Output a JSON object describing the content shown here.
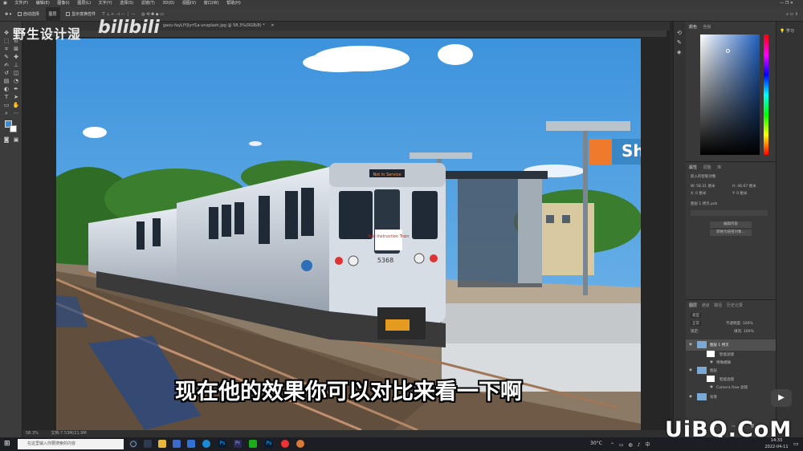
{
  "menubar": {
    "items": [
      "文件(F)",
      "编辑(E)",
      "图像(I)",
      "图层(L)",
      "文字(Y)",
      "选择(S)",
      "滤镜(T)",
      "3D(D)",
      "视图(V)",
      "窗口(W)",
      "帮助(H)"
    ]
  },
  "options": {
    "auto_select": "自动选择",
    "layer_select": "图层",
    "show_transform": "显示变换控件"
  },
  "document": {
    "tab_title": "gaou-fayLfYjlyrf1a-unsplash.jpg @ 58.3%(RGB/8) *"
  },
  "overlay": {
    "watermark": "野生设计湿",
    "bili": "bilibili",
    "subtitle": "现在他的效果你可以对比来看一下啊",
    "site_logo": "UiBQ.CoM"
  },
  "photo": {
    "station_sign": "She",
    "train_number": "5368",
    "train_label": "Not in Service",
    "rail_badge": "Rail Instruction Train"
  },
  "statusbar": {
    "zoom": "58.3%",
    "doc_size": "文档:7.53M/21.9M"
  },
  "panels": {
    "color": {
      "tabs": [
        "颜色",
        "色板"
      ]
    },
    "learn": "学习",
    "properties": {
      "tabs": [
        "属性",
        "调整",
        "库"
      ],
      "title": "嵌入的智能对象",
      "w_label": "W: 58.31 厘米",
      "h_label": "H: 46.67 厘米",
      "x_label": "X: 0 厘米",
      "y_label": "Y: 0 厘米",
      "file": "图层 1 拷贝.psb",
      "button_edit": "编辑内容",
      "button_convert": "转换为链接对象..."
    },
    "layers": {
      "tabs": [
        "图层",
        "通道",
        "路径",
        "历史记录"
      ],
      "kind": "类型",
      "blend": "正常",
      "opacity": "不透明度: 100%",
      "lock": "锁定:",
      "fill": "填充: 100%",
      "items": [
        {
          "name": "图层 1 拷贝",
          "selected": true
        },
        {
          "name": "智能滤镜",
          "selected": false
        },
        {
          "name": "特殊模糊",
          "selected": false
        },
        {
          "name": "图层",
          "selected": false
        },
        {
          "name": "智能滤镜",
          "selected": false
        },
        {
          "name": "Camera Raw 滤镜",
          "selected": false
        },
        {
          "name": "背景",
          "selected": false
        }
      ]
    }
  },
  "taskbar": {
    "search_placeholder": "在这里输入你要搜索的内容",
    "temp": "30°C",
    "time": "14:33",
    "date": "2022-04-11"
  },
  "colors": {
    "accent": "#31a8ff",
    "sky": "#5aa7e0",
    "ps_bg": "#282828"
  }
}
